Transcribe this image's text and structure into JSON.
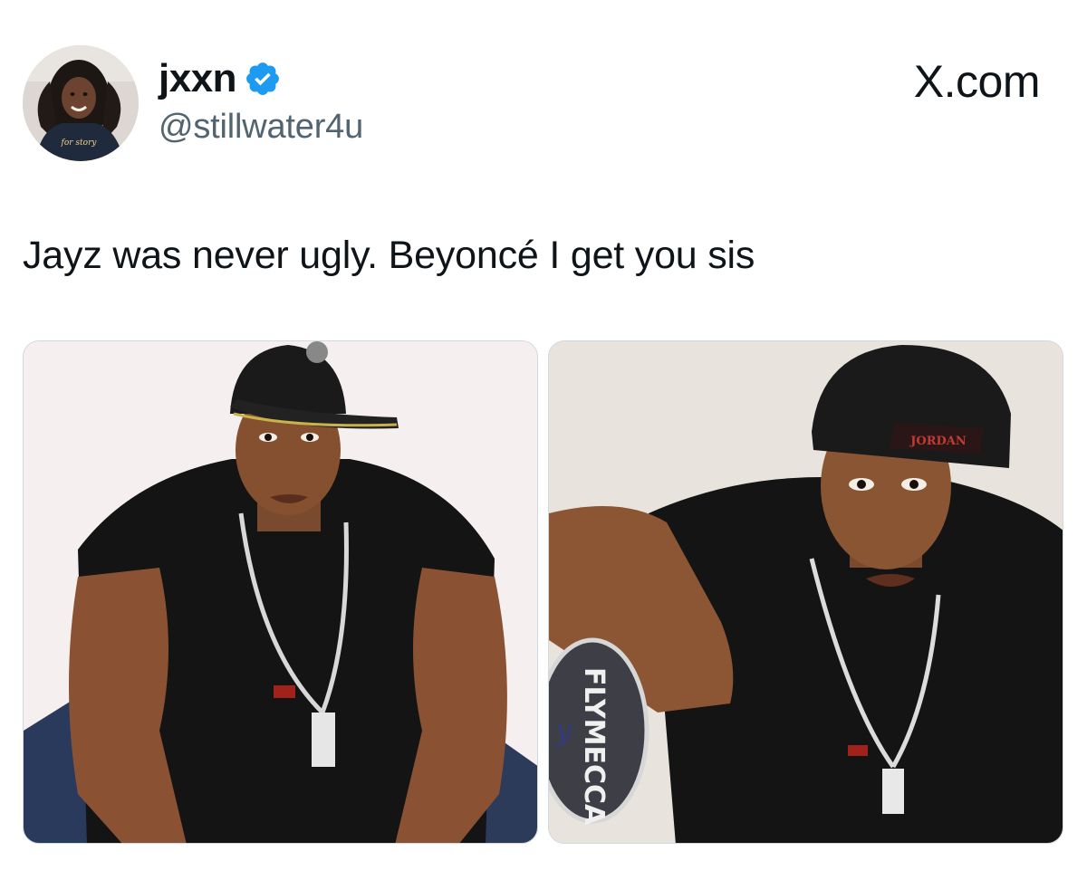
{
  "user": {
    "display_name": "jxxn",
    "handle": "@stillwater4u",
    "verified": true,
    "avatar_shirt_text": "for story",
    "avatar_icon": "profile-avatar"
  },
  "brand": {
    "label": "X.com",
    "icon": "x-logo-icon"
  },
  "tweet": {
    "text": "Jayz was never ugly. Beyoncé I get you sis"
  },
  "media": {
    "left": {
      "icon": "photo-man-black-cap-sleeveless-shirt"
    },
    "right": {
      "icon": "photo-man-pointing-jordan-cap",
      "cap_text": "JORDAN",
      "sticker_text": "FLYMECCA",
      "sticker_script": "y"
    }
  },
  "colors": {
    "text_primary": "#0f1419",
    "text_secondary": "#536471",
    "verified_blue": "#1d9bf0",
    "background": "#ffffff"
  }
}
